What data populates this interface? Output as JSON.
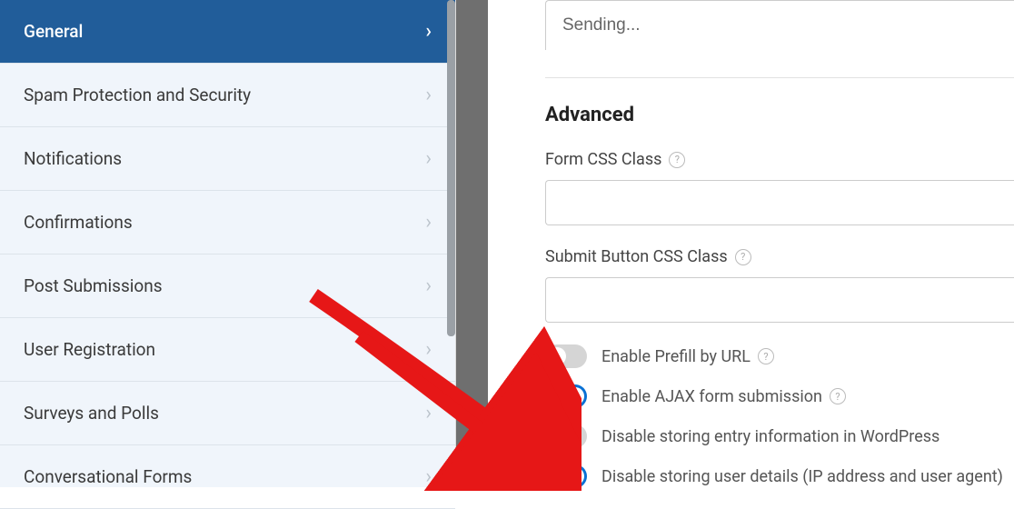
{
  "sidebar": {
    "items": [
      {
        "label": "General"
      },
      {
        "label": "Spam Protection and Security"
      },
      {
        "label": "Notifications"
      },
      {
        "label": "Confirmations"
      },
      {
        "label": "Post Submissions"
      },
      {
        "label": "User Registration"
      },
      {
        "label": "Surveys and Polls"
      },
      {
        "label": "Conversational Forms"
      }
    ]
  },
  "content": {
    "sending_value": "Sending...",
    "advanced_title": "Advanced",
    "form_css_label": "Form CSS Class",
    "form_css_value": "",
    "submit_css_label": "Submit Button CSS Class",
    "submit_css_value": "",
    "toggles": [
      {
        "label": "Enable Prefill by URL",
        "has_help": true
      },
      {
        "label": "Enable AJAX form submission",
        "has_help": true
      },
      {
        "label": "Disable storing entry information in WordPress",
        "has_help": false
      },
      {
        "label": "Disable storing user details (IP address and user agent)",
        "has_help": false
      }
    ]
  }
}
